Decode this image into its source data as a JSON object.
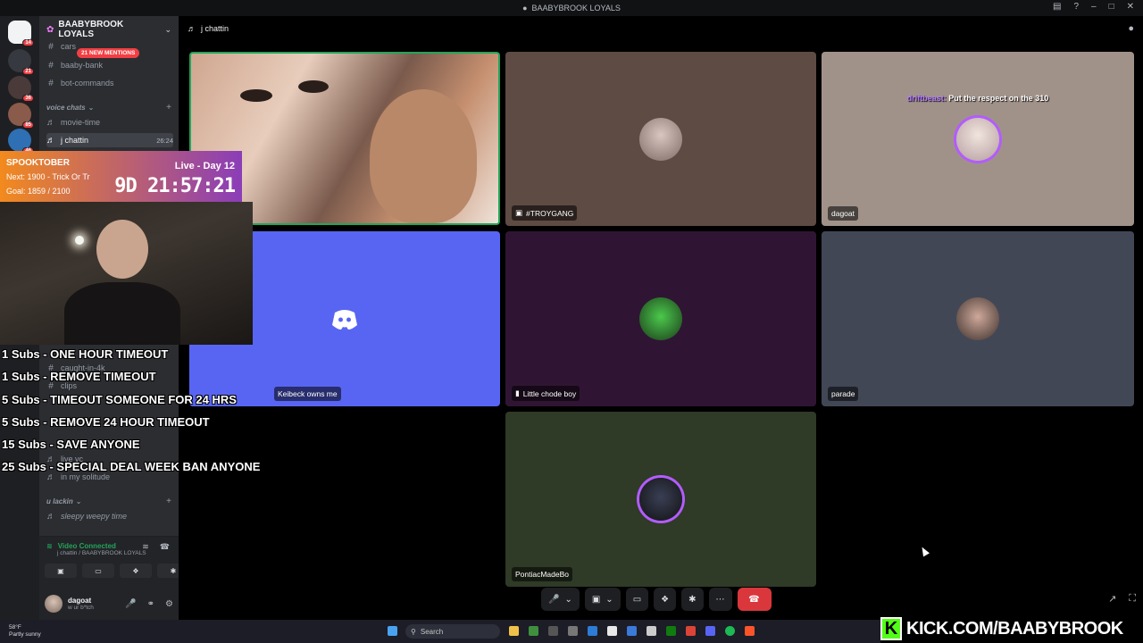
{
  "window": {
    "title": "BAABYBROOK LOYALS"
  },
  "server": {
    "name": "BAABYBROOK LOYALS",
    "mentions": "21 NEW MENTIONS"
  },
  "rail": {
    "badges": [
      "14",
      "21",
      "36",
      "85",
      "46"
    ]
  },
  "channels": {
    "text_top": [
      "cars",
      "baaby-bank",
      "bot-commands"
    ],
    "voice_category": "voice chats",
    "voice": [
      {
        "name": "movie-time",
        "active": false,
        "timer": ""
      },
      {
        "name": "j chattin",
        "active": true,
        "timer": "26:24"
      }
    ],
    "text_mid": [
      "caught-in-4k",
      "clips"
    ],
    "voice_lower": [
      "live vc",
      "in my solitude"
    ],
    "lower_category": "u lackin",
    "lower_voice": [
      "sleepy weepy time"
    ]
  },
  "voice_panel": {
    "status": "Video Connected",
    "sub": "j chattin / BAABYBROOK LOYALS"
  },
  "user_panel": {
    "name": "dagoat",
    "status": "w ur b*tch"
  },
  "call": {
    "channel": "j chattin",
    "tiles": [
      {
        "name": ""
      },
      {
        "name": "#TROYGANG"
      },
      {
        "name": "dagoat",
        "message_user": "driftbeast:",
        "message_text": "Put the respect on the 310"
      },
      {
        "name": "Keibeck owns me"
      },
      {
        "name": "Little chode boy"
      },
      {
        "name": "parade"
      },
      {
        "name": "PontiacMadeBo"
      }
    ]
  },
  "overlay": {
    "title": "SPOOKTOBER",
    "next": "Next: 1900 - Trick Or Tr",
    "goal": "Goal: 1859 / 2100",
    "live": "Live - Day 12",
    "clock": "9D 21:57:21",
    "subs": [
      "1 Subs - ONE HOUR TIMEOUT",
      "1 Subs - REMOVE TIMEOUT",
      "5 Subs - TIMEOUT SOMEONE FOR 24 HRS",
      "5 Subs - REMOVE 24 HOUR TIMEOUT",
      "15 Subs - SAVE ANYONE",
      "25 Subs - SPECIAL DEAL WEEK BAN ANYONE"
    ],
    "kick": "KICK.COM/BAABYBROOK"
  },
  "taskbar": {
    "temp": "58°F",
    "weather": "Partly sunny",
    "search": "Search"
  },
  "colors": {
    "accent": "#5865f2",
    "danger": "#da373c",
    "online": "#23a55a",
    "kick": "#53fc18"
  }
}
